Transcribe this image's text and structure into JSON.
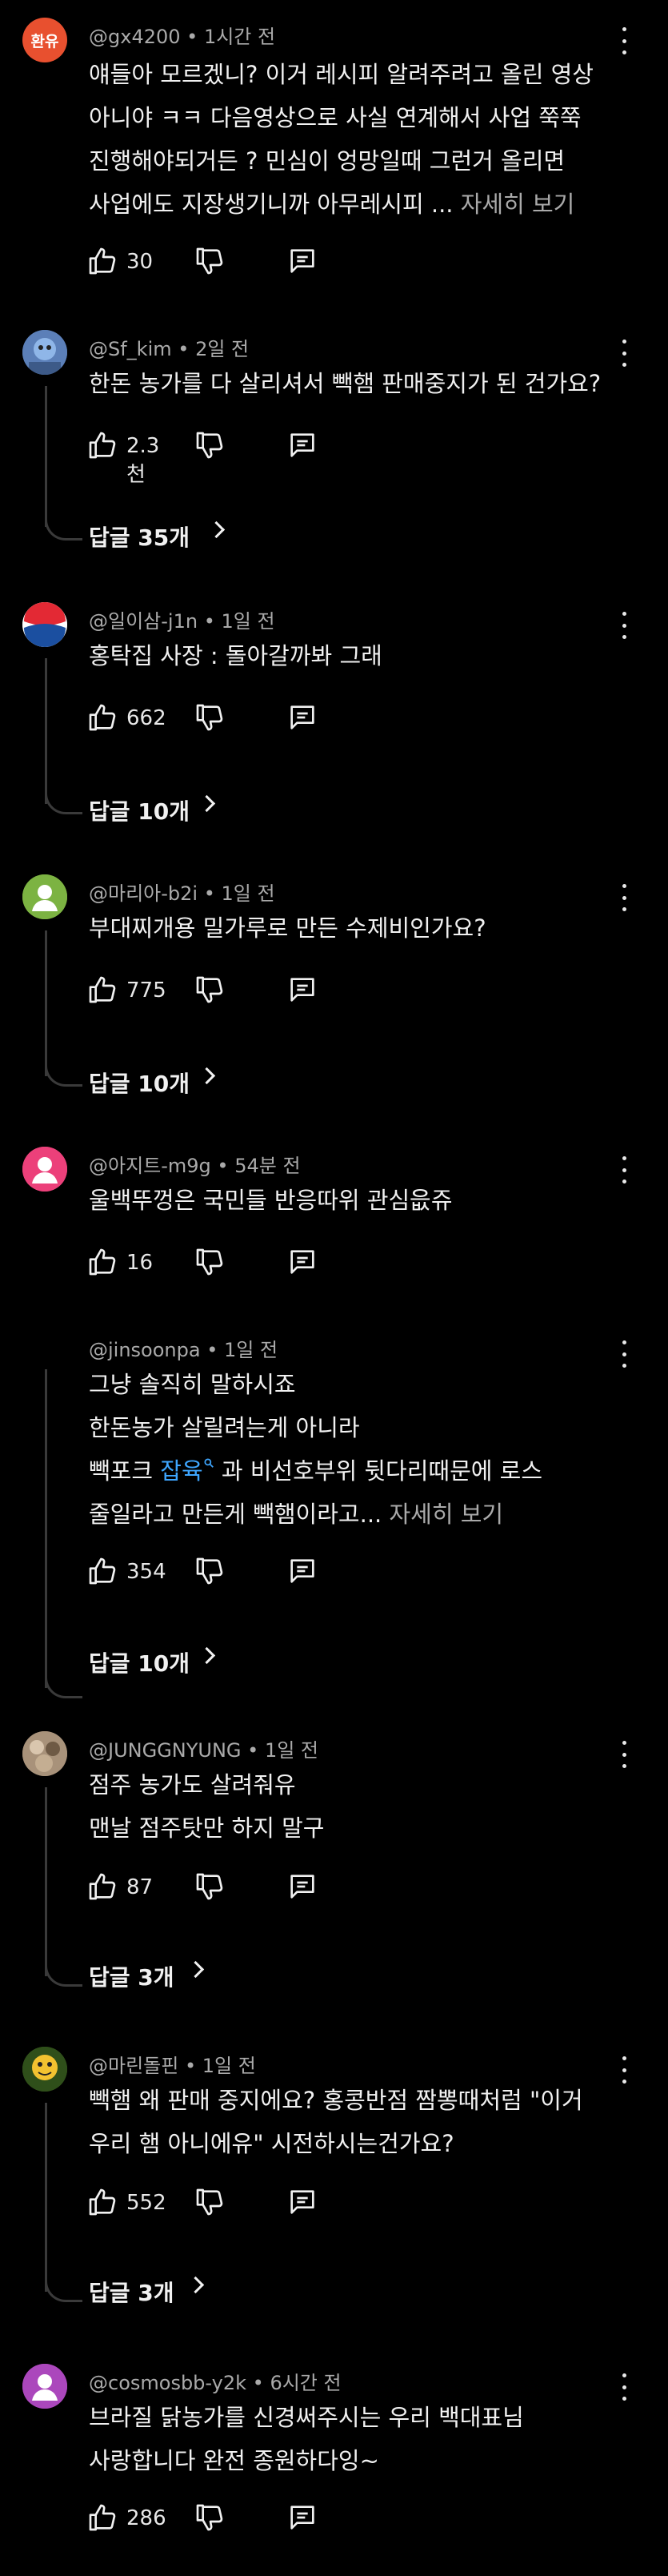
{
  "comments": [
    {
      "author": "@gx4200",
      "time": "1시간 전",
      "avatar_text": "환유",
      "lines": [
        "얘들아 모르겠니? 이거 레시피 알려주려고 올린 영상",
        "아니야 ㅋㅋ 다음영상으로 사실 연계해서 사업 쭉쭉",
        "진행해야되거든 ? 민심이 엉망일때 그런거 올리면",
        "사업에도 지장생기니까 아무레시피 ..."
      ],
      "more": "자세히 보기",
      "likes": "30"
    },
    {
      "author": "@Sf_kim",
      "time": "2일 전",
      "lines": [
        "한돈 농가를 다 살리셔서 빽햄 판매중지가 된 건가요?"
      ],
      "likes": "2.3천",
      "replies": "답글 35개"
    },
    {
      "author": "@일이삼-j1n",
      "time": "1일 전",
      "lines": [
        "홍탁집 사장 : 돌아갈까봐 그래"
      ],
      "likes": "662",
      "replies": "답글 10개"
    },
    {
      "author": "@마리아-b2i",
      "time": "1일 전",
      "lines": [
        "부대찌개용 밀가루로 만든 수제비인가요?"
      ],
      "likes": "775",
      "replies": "답글 10개"
    },
    {
      "author": "@아지트-m9g",
      "time": "54분 전",
      "lines": [
        "울백뚜껑은 국민들 반응따위 관심읎쥬"
      ],
      "likes": "16"
    },
    {
      "author": "@jinsoonpa",
      "time": "1일 전",
      "lines": [
        "그냥 솔직히 말하시죠",
        "한돈농가 살릴려는게 아니라"
      ],
      "line3_pre": "빽포크 ",
      "line3_link": "잡육",
      "line3_post": " 과 비선호부위 뒷다리때문에 로스",
      "line4": "줄일라고 만든게 빽햄이라고...",
      "more": "자세히 보기",
      "likes": "354",
      "replies": "답글 10개"
    },
    {
      "author": "@JUNGGNYUNG",
      "time": "1일 전",
      "lines": [
        "점주 농가도 살려줘유",
        "맨날 점주탓만 하지 말구"
      ],
      "likes": "87",
      "replies": "답글 3개"
    },
    {
      "author": "@마린돌핀",
      "time": "1일 전",
      "lines": [
        "빽햄 왜 판매 중지에요? 홍콩반점 짬뽕때처럼 \"이거",
        "우리 햄 아니에유\" 시전하시는건가요?"
      ],
      "likes": "552",
      "replies": "답글 3개"
    },
    {
      "author": "@cosmosbb-y2k",
      "time": "6시간 전",
      "lines": [
        "브라질 닭농가를 신경써주시는 우리 백대표님",
        "사랑합니다 완전 종원하다잉~"
      ],
      "likes": "286"
    }
  ],
  "sep": " • "
}
